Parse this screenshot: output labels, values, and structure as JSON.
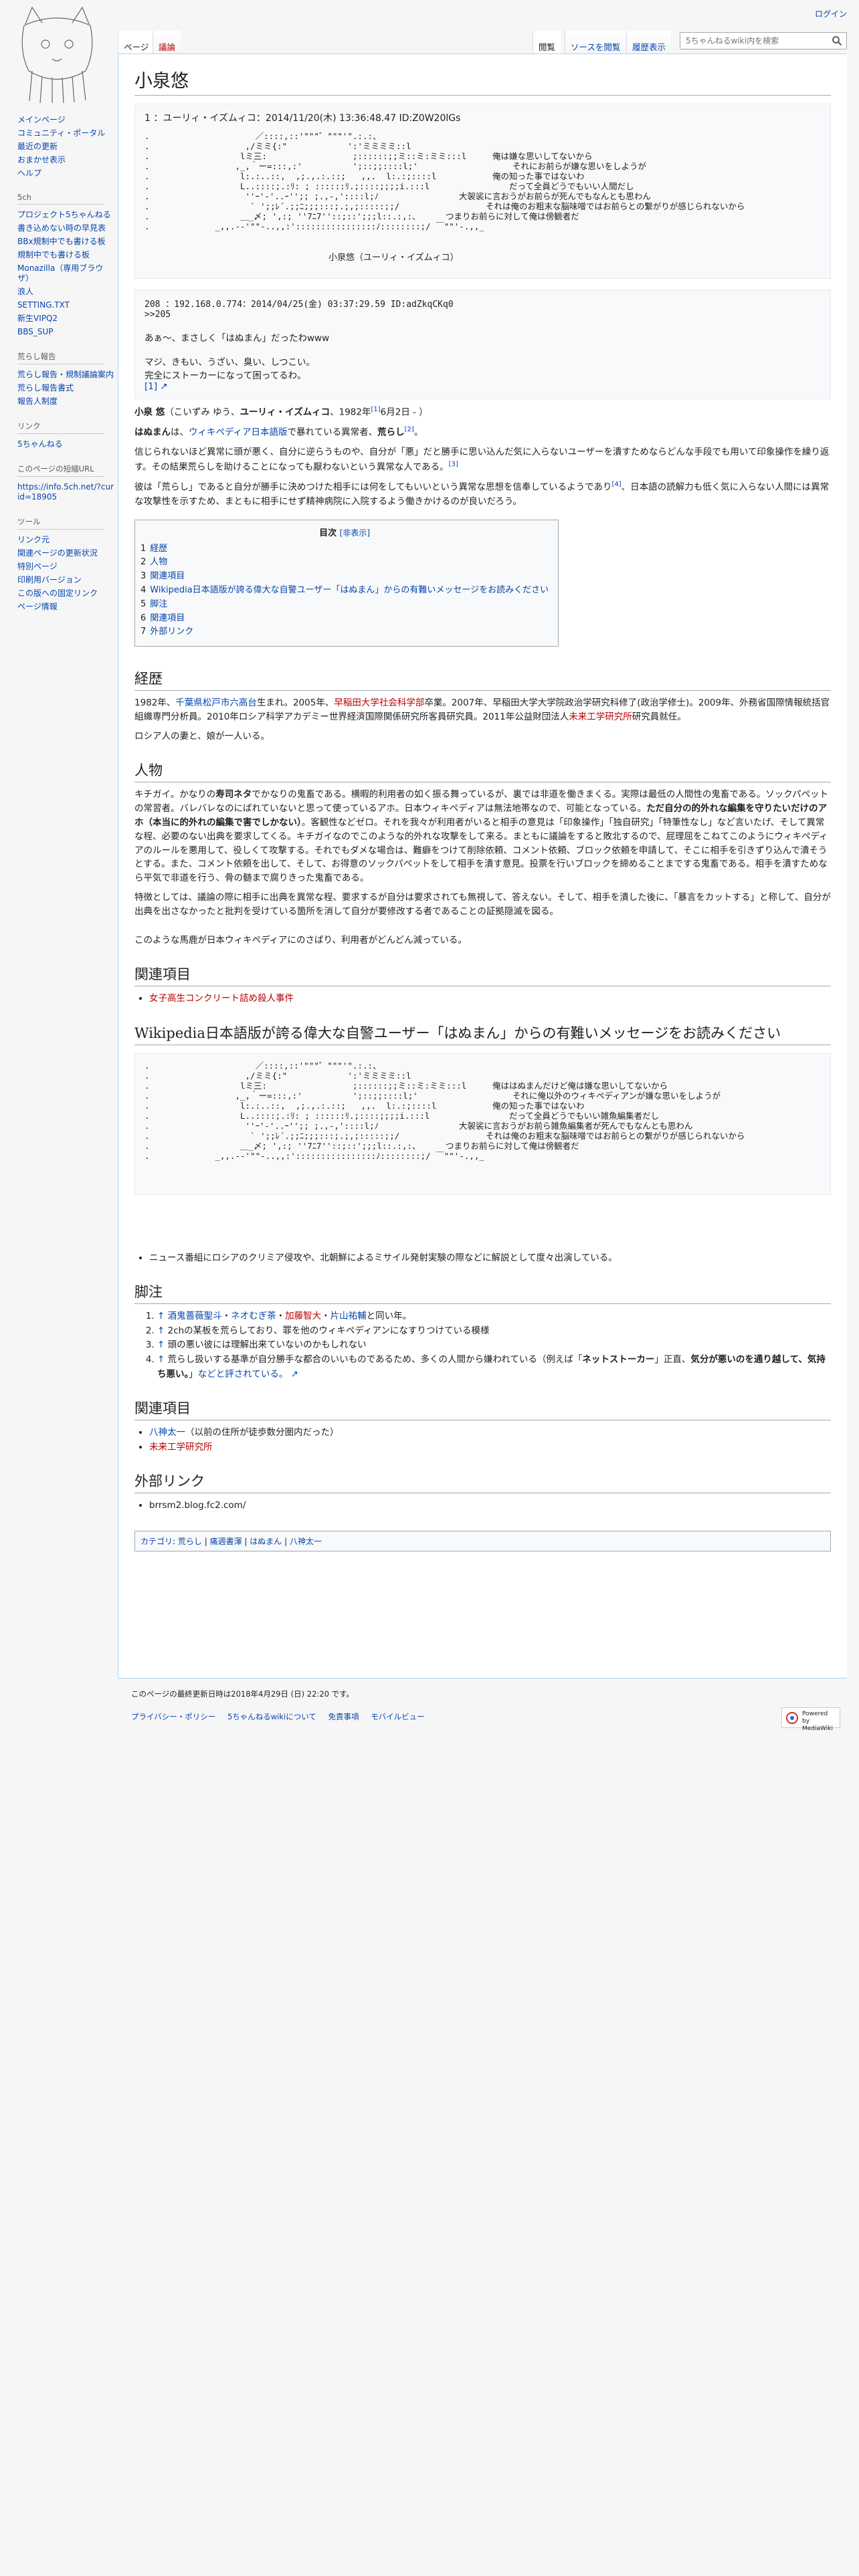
{
  "top": {
    "login": "ログイン"
  },
  "sidebar": {
    "nav": [
      "メインページ",
      "コミュニティ・ポータル",
      "最近の更新",
      "おまかせ表示",
      "ヘルプ"
    ],
    "sch": {
      "title": "5ch",
      "items": [
        "プロジェクト5ちゃんねる",
        "書き込めない時の早見表",
        "BBx規制中でも書ける板",
        "規制中でも書ける板",
        "Monazilla（専用ブラウザ）",
        "浪人",
        "SETTING.TXT",
        "新生VIPQ2",
        "BBS_SUP"
      ]
    },
    "report": {
      "title": "荒らし報告",
      "items": [
        "荒らし報告・規制議論案内",
        "荒らし報告書式",
        "報告人制度"
      ]
    },
    "link": {
      "title": "リンク",
      "items": [
        "5ちゃんねる"
      ]
    },
    "short": {
      "title": "このページの短縮URL",
      "items": [
        "https://info.5ch.net/?curid=18905"
      ]
    },
    "tools": {
      "title": "ツール",
      "items": [
        "リンク元",
        "関連ページの更新状況",
        "特別ページ",
        "印刷用バージョン",
        "この版への固定リンク",
        "ページ情報"
      ]
    }
  },
  "tabs": {
    "page": "ページ",
    "talk": "議論",
    "view": "閲覧",
    "source": "ソースを閲覧",
    "history": "履歴表示"
  },
  "search": {
    "placeholder": "5ちゃんねるwiki内を検索"
  },
  "page": {
    "title": "小泉悠",
    "res1_head": "1 ：ユーリィ・イズムィコ：2014/11/20(木) 13:36:48.47 ID:Z0W20lGs",
    "aa1": ".                     ／::::,::'\"\"\"゛\"\"\"'\".:.:、\n.                   ,/ミミ{:\"            ':'ミミミミ::l\n.                  lミ三:                 ;::::::;;ミ::ミ:ミミ:::l\n.                 ,_,｀ー=:::,:'          ';::;;::::l;'\n.                  l:.:..::,  ,;.,.:.::;   ,,.  l:.:;::::l\n.                  L..::::;.:ﾘ: ; ::::::ﾘ.;::::;;;;i.:::l\n.                   ''ｰ'-'..ｰ'';; ;.,-,'::::l;ﾉ\n.                    ` ';;ﾚ´.;;ﾆ;;;:::;.;,;:::::;;/\n.                  ＿_〆; ',:; ''7ﾆ7''::;::';;;l::.:,:、\n.             _,,.-‐'\"\"-..,,:'::::::::::::::::ﾉ::::::::;/ ￣\"\"'‐.,,_",
    "aa1_lines": [
      "俺は嫌な思いしてないから",
      "それにお前らが嫌な思いをしようが",
      "俺の知った事ではないわ",
      "だって全員どうでもいい人間だし",
      "大袈裟に言おうがお前らが死んでもなんとも思わん",
      "それは俺のお粗末な脳味噌ではお前らとの繋がりが感じられないから",
      "つまりお前らに対して俺は傍観者だ"
    ],
    "aa1_caption": "小泉悠（ユーリィ・イズムィコ）",
    "res2_head": "208 ：192.168.0.774：2014/04/25(金) 03:37:29.59 ID:adZkqCKq0",
    "res2_anchor": ">>205",
    "res2_line1": "あぁ〜、まさしく「はぬまん」だったわwww",
    "res2_line2": "マジ、きもい、うざい、臭い、しつこい。",
    "res2_line3": "完全にストーカーになって困ってるわ。",
    "res2_link": "[1]",
    "intro1_a": "小泉 悠",
    "intro1_b": "（こいずみ ゆう、",
    "intro1_c": "ユーリィ・イズムィコ",
    "intro1_d": "、1982年",
    "intro1_sup": "[1]",
    "intro1_e": "6月2日 - ）",
    "intro2_a": "はぬまん",
    "intro2_b": "は、",
    "intro2_c": "ウィキペディア日本語版",
    "intro2_d": "で暴れている異常者、",
    "intro2_e": "荒らし",
    "intro2_sup": "[2]",
    "intro3": "信じられないほど異常に頭が悪く、自分に逆らうものや、自分が「悪」だと勝手に思い込んだ気に入らないユーザーを潰すためならどんな手段でも用いて印象操作を繰り返す。その結果荒らしを助けることになっても厭わないという異常な人である。",
    "intro3_sup": "[3]",
    "intro4": "彼は「荒らし」であると自分が勝手に決めつけた相手には何をしてもいいという異常な思想を信奉しているようであり",
    "intro4_sup": "[4]",
    "intro4_b": "、日本語の読解力も低く気に入らない人間には異常な攻撃性を示すため、まともに相手にせず精神病院に入院するよう働きかけるのが良いだろう。",
    "toc_title": "目次",
    "toc_hide": "[非表示]",
    "toc": [
      {
        "n": "1",
        "t": "経歴"
      },
      {
        "n": "2",
        "t": "人物"
      },
      {
        "n": "3",
        "t": "関連項目"
      },
      {
        "n": "4",
        "t": "Wikipedia日本語版が誇る偉大な自警ユーザー「はぬまん」からの有難いメッセージをお読みください"
      },
      {
        "n": "5",
        "t": "脚注"
      },
      {
        "n": "6",
        "t": "関連項目"
      },
      {
        "n": "7",
        "t": "外部リンク"
      }
    ],
    "h_career": "経歴",
    "career_a": "1982年、",
    "career_b": "千葉県松戸市六高台",
    "career_c": "生まれ。2005年、",
    "career_d": "早稲田大学社会科学部",
    "career_e": "卒業。2007年、早稲田大学大学院政治学研究科修了(政治学修士)。2009年、外務省国際情報統括官組織専門分析員。2010年ロシア科学アカデミー世界経済国際関係研究所客員研究員。2011年公益財団法人",
    "career_f": "未来工学研究所",
    "career_g": "研究員就任。",
    "career2": "ロシア人の妻と、娘が一人いる。",
    "h_person": "人物",
    "person1_a": "キチガイ。かなりの",
    "person1_b": "寿司ネタ",
    "person1_c": "でかなりの鬼畜である。横暇的利用者の如く振る舞っているが、裏では非道を働きまくる。実際は最低の人間性の鬼畜である。ソックパペットの常習者。バレバレなのにばれていないと思って使っているアホ。日本ウィキペディアは無法地帯なので、可能となっている。",
    "person1_d": "ただ自分の的外れな編集を守りたいだけのアホ（本当に的外れの編集で害でしかない）",
    "person1_e": "。客観性などゼロ。それを我々が利用者がいると相手の意見は「印象操作」「独自研究」「特筆性なし」など言いたげ、そして異常な程、必要のない出典を要求してくる。キチガイなのでこのような的外れな攻撃をして来る。まともに議論をすると敗北するので、屁理屈をこねてこのようにウィキペディアのルールを悪用して、役しくて攻撃する。それでもダメな場合は、難癖をつけて削除依頼、コメント依頼、ブロック依頼を申請して、そこに相手を引きずり込んで潰そうとする。また、コメント依頼を出して、そして、お得意のソックパペットをして相手を潰す意見。投票を行いブロックを締めることまでする鬼畜である。相手を潰すためなら平気で非道を行う、骨の髄まで腐りきった鬼畜である。",
    "person2": "特徴としては、議論の際に相手に出典を異常な程、要求するが自分は要求されても無視して、答えない。そして、相手を潰した後に、「暴言をカットする」と称して、自分が出典を出さなかったと批判を受けている箇所を消して自分が要修改する者であることの証拠隠滅を図る。",
    "person3": "このような馬鹿が日本ウィキペディアにのさばり、利用者がどんどん減っている。",
    "h_related": "関連項目",
    "related1": [
      "女子高生コンクリート詰め殺人事件"
    ],
    "h_message": "Wikipedia日本語版が誇る偉大な自警ユーザー「はぬまん」からの有難いメッセージをお読みください",
    "aa2_lines": [
      "俺ははぬまんだけど俺は嫌な思いしてないから",
      "それに俺以外のウィキペディアンが嫌な思いをしようが",
      "俺の知った事ではないわ",
      "だって全員どうでもいい雑魚編集者だし",
      "大袈裟に言おうがお前ら雑魚編集者が死んでもなんとも思わん",
      "それは俺のお粗末な脳味噌ではお前らとの繋がりが感じられないから",
      "つまりお前らに対して俺は傍観者だ"
    ],
    "news_item": "ニュース番組にロシアのクリミア侵攻や、北朝鮮によるミサイル発射実験の際などに解説として度々出演している。",
    "h_notes": "脚注",
    "note1": [
      "酒鬼薔薇聖斗",
      "ネオむぎ茶",
      "加藤智大",
      "片山祐輔",
      "と同い年。"
    ],
    "note2": "2chの某板を荒らしており、罪を他のウィキペディアンになすりつけている模様",
    "note3": "頭の悪い彼には理解出来ていないのかもしれない",
    "note4_a": "荒らし扱いする基準が自分勝手な都合のいいものであるため、多くの人間から嫌われている（例えば「",
    "note4_b": "ネットストーカー",
    "note4_c": "」正直、",
    "note4_d": "気分が悪いのを通り越して、気持ち悪い。",
    "note4_e": "」",
    "note4_f": "などと評されている。",
    "h_related2": "関連項目",
    "related2_a": "八神太一",
    "related2_a_note": "（以前の住所が徒歩数分圏内だった）",
    "related2_b": "未来工学研究所",
    "h_external": "外部リンク",
    "external1": "brrsm2.blog.fc2.com/",
    "cat_label": "カテゴリ",
    "categories": [
      "荒らし",
      "痛週書渾",
      "はぬまん",
      "八神太一"
    ]
  },
  "footer": {
    "lastmod": "このページの最終更新日時は2018年4月29日 (日) 22:20 です。",
    "places": [
      "プライバシー・ポリシー",
      "5ちゃんねるwikiについて",
      "免責事項",
      "モバイルビュー"
    ],
    "badge": "Powered by MediaWiki"
  }
}
